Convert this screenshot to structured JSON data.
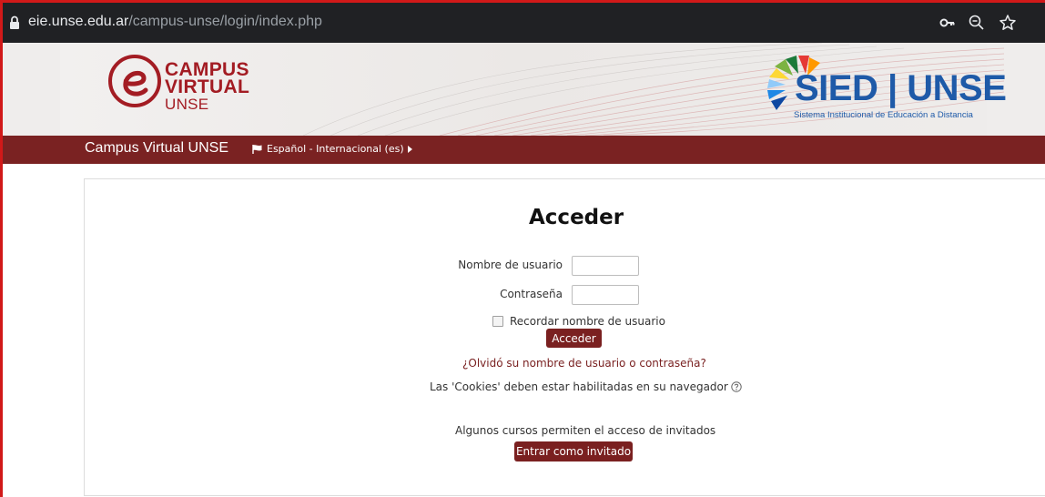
{
  "browser": {
    "url_host": "eie.unse.edu.ar",
    "url_path": "/campus-unse/login/index.php",
    "icons": [
      "lock-icon",
      "key-icon",
      "zoom-icon",
      "star-icon"
    ]
  },
  "banner": {
    "campus_line1": "CAMPUS",
    "campus_line2": "VIRTUAL",
    "campus_line3": "UNSE",
    "sied_title": "SIED | UNSE",
    "sied_subtitle": "Sistema Institucional de Educación a Distancia"
  },
  "navbar": {
    "brand": "Campus Virtual UNSE",
    "language": "Español - Internacional (es)"
  },
  "login": {
    "heading": "Acceder",
    "username_label": "Nombre de usuario",
    "username_value": "",
    "password_label": "Contraseña",
    "password_value": "",
    "remember_label": "Recordar nombre de usuario",
    "remember_checked": false,
    "submit_label": "Acceder",
    "forgot_link": "¿Olvidó su nombre de usuario o contraseña?",
    "cookies_text": "Las 'Cookies' deben estar habilitadas en su navegador",
    "guests_text": "Algunos cursos permiten el acceso de invitados",
    "guest_button": "Entrar como invitado"
  },
  "colors": {
    "brand_maroon": "#7a2222",
    "frame_red": "#d11919",
    "sied_blue": "#1e5aa8"
  }
}
